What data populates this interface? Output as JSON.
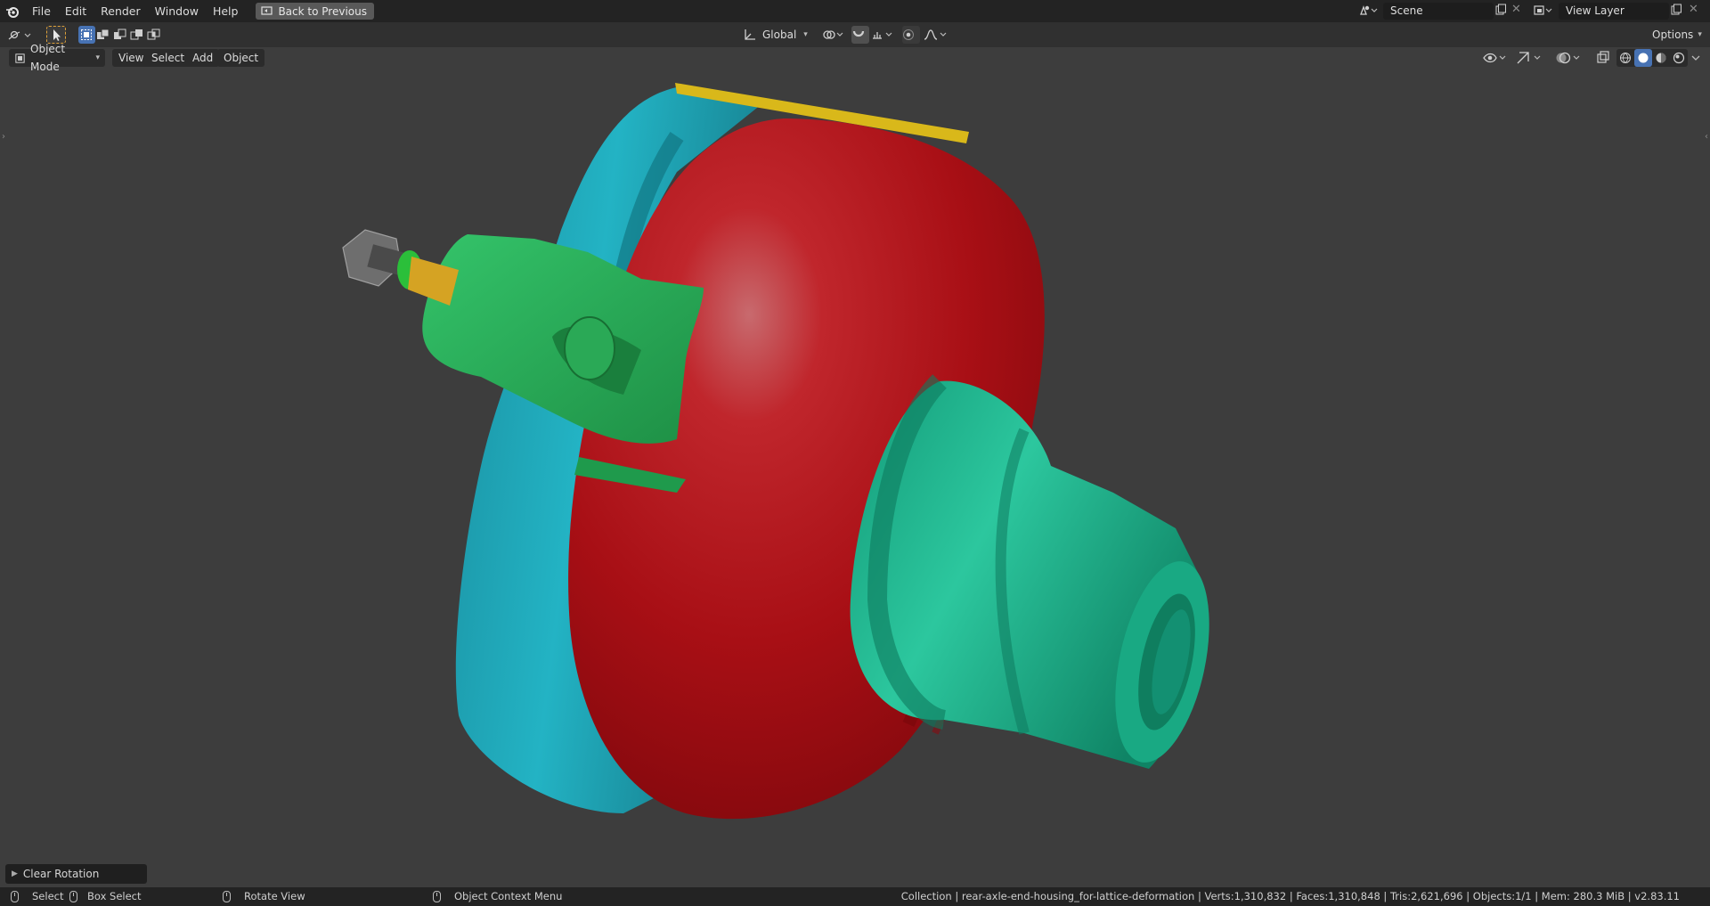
{
  "menu": {
    "items": [
      "File",
      "Edit",
      "Render",
      "Window",
      "Help"
    ],
    "back_button": "Back to Previous"
  },
  "scene": {
    "name": "Scene",
    "view_layer": "View Layer"
  },
  "toolbar": {
    "orientation": "Global",
    "options_label": "Options"
  },
  "viewport_header": {
    "mode": "Object Mode",
    "menus": [
      "View",
      "Select",
      "Add",
      "Object"
    ]
  },
  "redo_panel": {
    "label": "Clear Rotation"
  },
  "statusbar": {
    "select": "Select",
    "box_select": "Box Select",
    "rotate_view": "Rotate View",
    "context_menu": "Object Context Menu",
    "stats": "Collection | rear-axle-end-housing_for-lattice-deformation | Verts:1,310,832 | Faces:1,310,848 | Tris:2,621,696 | Objects:1/1 | Mem: 280.3 MiB | v2.83.11"
  },
  "colors": {
    "accent": "#4772b3",
    "housing_red": "#b3121a",
    "flange_cyan": "#1fa3b4",
    "bracket_green": "#2bb15a",
    "tube_teal": "#1cae8c",
    "edge_yellow": "#e0c21a"
  }
}
